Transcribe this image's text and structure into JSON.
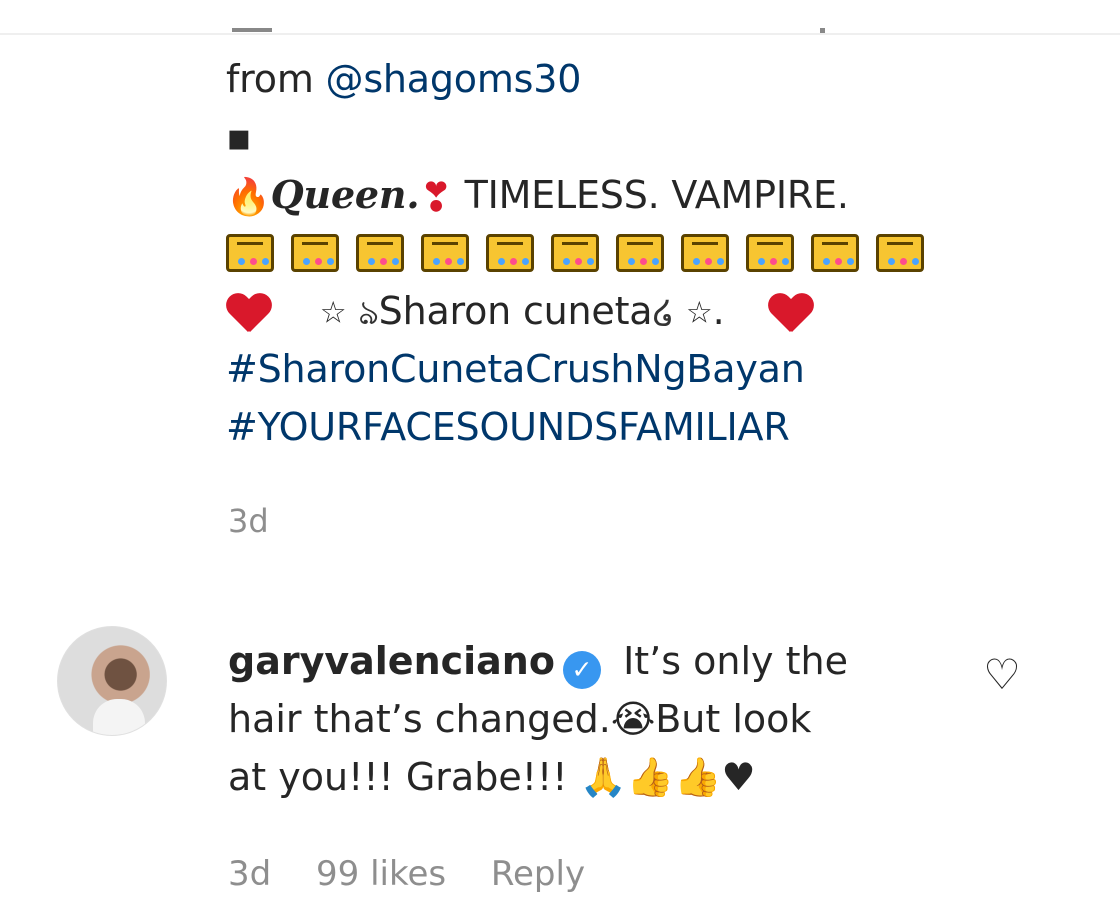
{
  "caption": {
    "prefix": "from ",
    "mention": "@shagoms30",
    "dot": "▪",
    "queen": "Queen.",
    "timeless": " TIMELESS. VAMPIRE.",
    "crowns": [
      "crown-icon",
      "crown-icon",
      "crown-icon",
      "crown-icon",
      "crown-icon",
      "crown-icon",
      "crown-icon",
      "crown-icon",
      "crown-icon",
      "crown-icon",
      "crown-icon"
    ],
    "sharon_text": "Sharon cuneta",
    "star": "☆",
    "period": ".",
    "hashtags": [
      "#SharonCunetaCrushNgBayan",
      "#YOURFACESOUNDSFAMILIAR"
    ],
    "time": "3d"
  },
  "comment": {
    "username": "garyvalenciano",
    "verified_mark": "✓",
    "text_part1": " It’s only the",
    "text_part2": "hair that’s changed.",
    "text_part3": "But look",
    "text_part4": "at you!!! Grabe!!! ",
    "time": "3d",
    "likes": "99 likes",
    "reply": "Reply"
  },
  "colors": {
    "hashtag": "#00376b",
    "muted": "#8e8e8e",
    "verified": "#3897f0",
    "heart": "#d9182b"
  },
  "icons": [
    "fire-icon",
    "heart-exclamation-icon",
    "crown-icon",
    "heart-icon",
    "star-icon",
    "swirl-icon",
    "verified-icon",
    "crying-face-icon",
    "praying-hands-icon",
    "thumbs-up-icon",
    "black-heart-icon",
    "like-heart-icon"
  ]
}
